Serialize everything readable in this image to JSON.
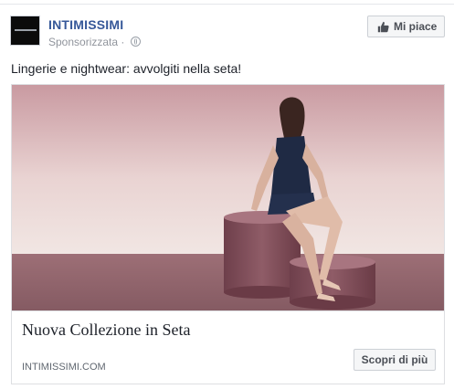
{
  "post": {
    "page_name": "INTIMISSIMI",
    "sponsored_label": "Sponsorizzata",
    "separator": "·",
    "message": "Lingerie e nightwear: avvolgiti nella seta!"
  },
  "actions": {
    "like_label": "Mi piace"
  },
  "link": {
    "headline": "Nuova Collezione in Seta",
    "domain": "INTIMISSIMI.COM",
    "cta_label": "Scopri di più"
  },
  "icons": {
    "like": "thumbs-up-icon",
    "audience": "globe-icon"
  },
  "colors": {
    "page_name": "#365899",
    "muted_text": "#90949c",
    "button_bg": "#f5f6f7",
    "border": "#dddfe2"
  }
}
